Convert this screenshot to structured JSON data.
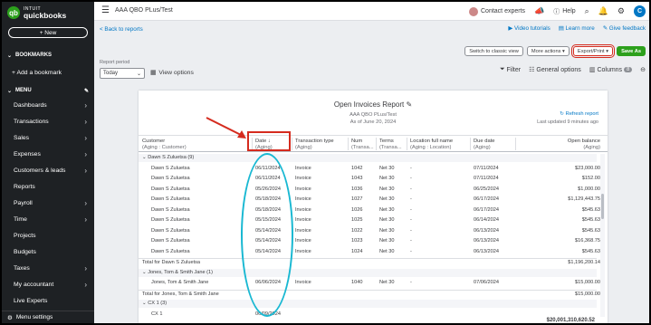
{
  "brand": {
    "intuit": "INTUIT",
    "product": "quickbooks",
    "logo_letter": "qb"
  },
  "sidebar": {
    "new_label": "+ New",
    "bookmarks_label": "BOOKMARKS",
    "add_bookmark_label": "+ Add a bookmark",
    "menu_label": "MENU",
    "items": [
      {
        "label": "Dashboards"
      },
      {
        "label": "Transactions"
      },
      {
        "label": "Sales"
      },
      {
        "label": "Expenses"
      },
      {
        "label": "Customers & leads"
      },
      {
        "label": "Reports"
      },
      {
        "label": "Payroll"
      },
      {
        "label": "Time"
      },
      {
        "label": "Projects"
      },
      {
        "label": "Budgets"
      },
      {
        "label": "Taxes"
      },
      {
        "label": "My accountant"
      },
      {
        "label": "Live Experts"
      }
    ],
    "footer_label": "Menu settings"
  },
  "topbar": {
    "company": "AAA QBO PLus/Test",
    "contact_experts": "Contact experts",
    "help": "Help",
    "user_initial": "C"
  },
  "subheader": {
    "back_label": "< Back to reports",
    "video_tutorials": "Video tutorials",
    "learn_more": "Learn more",
    "give_feedback": "Give feedback"
  },
  "actions": {
    "switch_classic": "Switch to classic view",
    "more_actions": "More actions ▾",
    "export_print": "Export/Print ▾",
    "save_as": "Save As"
  },
  "period": {
    "label": "Report period",
    "value": "Today"
  },
  "view_options_label": "View options",
  "tools": {
    "filter": "Filter",
    "general_options": "General options",
    "columns": "Columns",
    "columns_count": "8"
  },
  "report": {
    "title": "Open Invoices Report",
    "company": "AAA QBO PLus/Test",
    "as_of": "As of June 20, 2024",
    "refresh": "Refresh report",
    "updated": "Last updated 9 minutes ago",
    "columns": [
      {
        "label": "Customer",
        "sub": "(Aging : Customer)"
      },
      {
        "label": "Date ↓",
        "sub": "(Aging)"
      },
      {
        "label": "Transaction type",
        "sub": "(Aging)"
      },
      {
        "label": "Num",
        "sub": "(Transa..."
      },
      {
        "label": "Terms",
        "sub": "(Transa..."
      },
      {
        "label": "Location full name",
        "sub": "(Aging : Location)"
      },
      {
        "label": "Due date",
        "sub": "(Aging)"
      },
      {
        "label": "Open balance",
        "sub": "(Aging)"
      }
    ],
    "rows": [
      {
        "kind": "group",
        "customer": "⌄ Dawn S Zuluetsa (9)"
      },
      {
        "kind": "data",
        "customer": "Dawn S Zuluetsa",
        "date": "06/11/2024",
        "type": "Invoice",
        "num": "1042",
        "terms": "Net 30",
        "loc": "-",
        "due": "07/11/2024",
        "bal": "$23,000.00"
      },
      {
        "kind": "data",
        "customer": "Dawn S Zuluetsa",
        "date": "06/11/2024",
        "type": "Invoice",
        "num": "1043",
        "terms": "Net 30",
        "loc": "-",
        "due": "07/11/2024",
        "bal": "$152.00"
      },
      {
        "kind": "data",
        "customer": "Dawn S Zuluetsa",
        "date": "05/26/2024",
        "type": "Invoice",
        "num": "1036",
        "terms": "Net 30",
        "loc": "-",
        "due": "06/25/2024",
        "bal": "$1,000.00"
      },
      {
        "kind": "data",
        "customer": "Dawn S Zuluetsa",
        "date": "05/18/2024",
        "type": "Invoice",
        "num": "1027",
        "terms": "Net 30",
        "loc": "-",
        "due": "06/17/2024",
        "bal": "$1,129,443.75"
      },
      {
        "kind": "data",
        "customer": "Dawn S Zuluetsa",
        "date": "05/18/2024",
        "type": "Invoice",
        "num": "1026",
        "terms": "Net 30",
        "loc": "-",
        "due": "06/17/2024",
        "bal": "$545.63"
      },
      {
        "kind": "data",
        "customer": "Dawn S Zuluetsa",
        "date": "05/15/2024",
        "type": "Invoice",
        "num": "1025",
        "terms": "Net 30",
        "loc": "-",
        "due": "06/14/2024",
        "bal": "$545.63"
      },
      {
        "kind": "data",
        "customer": "Dawn S Zuluetsa",
        "date": "05/14/2024",
        "type": "Invoice",
        "num": "1022",
        "terms": "Net 30",
        "loc": "-",
        "due": "06/13/2024",
        "bal": "$545.63"
      },
      {
        "kind": "data",
        "customer": "Dawn S Zuluetsa",
        "date": "05/14/2024",
        "type": "Invoice",
        "num": "1023",
        "terms": "Net 30",
        "loc": "-",
        "due": "06/13/2024",
        "bal": "$16,368.75"
      },
      {
        "kind": "data",
        "customer": "Dawn S Zuluetsa",
        "date": "05/14/2024",
        "type": "Invoice",
        "num": "1024",
        "terms": "Net 30",
        "loc": "-",
        "due": "06/13/2024",
        "bal": "$545.63"
      },
      {
        "kind": "total",
        "customer": "Total for Dawn S Zuluetsa",
        "bal": "$1,196,200.14"
      },
      {
        "kind": "group",
        "customer": "⌄ Jones, Tom & Smith Jane (1)"
      },
      {
        "kind": "data",
        "customer": "Jones, Tom & Smith Jane",
        "date": "06/06/2024",
        "type": "Invoice",
        "num": "1040",
        "terms": "Net 30",
        "loc": "-",
        "due": "07/06/2024",
        "bal": "$15,000.00"
      },
      {
        "kind": "total",
        "customer": "Total for Jones, Tom & Smith Jane",
        "bal": "$15,000.00"
      },
      {
        "kind": "group",
        "customer": "⌄ CX 1 (3)"
      },
      {
        "kind": "data",
        "customer": "CX 1",
        "date": "06/09/2024",
        "type": "",
        "num": "",
        "terms": "",
        "loc": "",
        "due": "",
        "bal": ""
      }
    ],
    "grand_total": "$20,001,310,620.52"
  },
  "colors": {
    "accent": "#2ca01c",
    "link": "#0077c5",
    "sidebar": "#1e2124",
    "annotation_box": "#d52b1e",
    "annotation_ellipse": "#19b8d2"
  }
}
